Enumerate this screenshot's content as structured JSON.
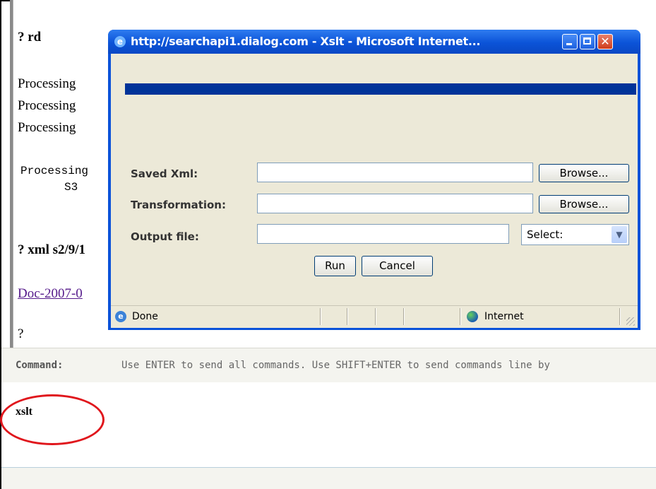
{
  "console": {
    "line1": "? rd",
    "line2": "Processing",
    "line3": "Processing",
    "line4": "Processing",
    "line5": "Processing",
    "line6": "S3",
    "line7": "? xml s2/9/1",
    "link": "Doc-2007-0",
    "line8": "?"
  },
  "command": {
    "label": "Command:",
    "hint": "Use ENTER to send all commands. Use SHIFT+ENTER to send commands line by",
    "input_value": "xslt"
  },
  "popup": {
    "title": "http://searchapi1.dialog.com - Xslt - Microsoft Internet...",
    "saved_xml_label": "Saved Xml:",
    "saved_xml_value": "",
    "transformation_label": "Transformation:",
    "transformation_value": "",
    "output_file_label": "Output file:",
    "output_file_value": "",
    "browse_label": "Browse...",
    "select_value": "Select:",
    "run_label": "Run",
    "cancel_label": "Cancel",
    "status_done": "Done",
    "status_zone": "Internet"
  },
  "colors": {
    "title_blue": "#0a52d9",
    "progress_bar": "#003399",
    "highlight_circle": "#e0161c",
    "link": "#551a8b"
  },
  "icons": {
    "title": "ie-icon",
    "minimize": "minimize-icon",
    "maximize": "maximize-icon",
    "close": "close-icon",
    "status_page": "ie-page-icon",
    "zone": "globe-icon"
  }
}
